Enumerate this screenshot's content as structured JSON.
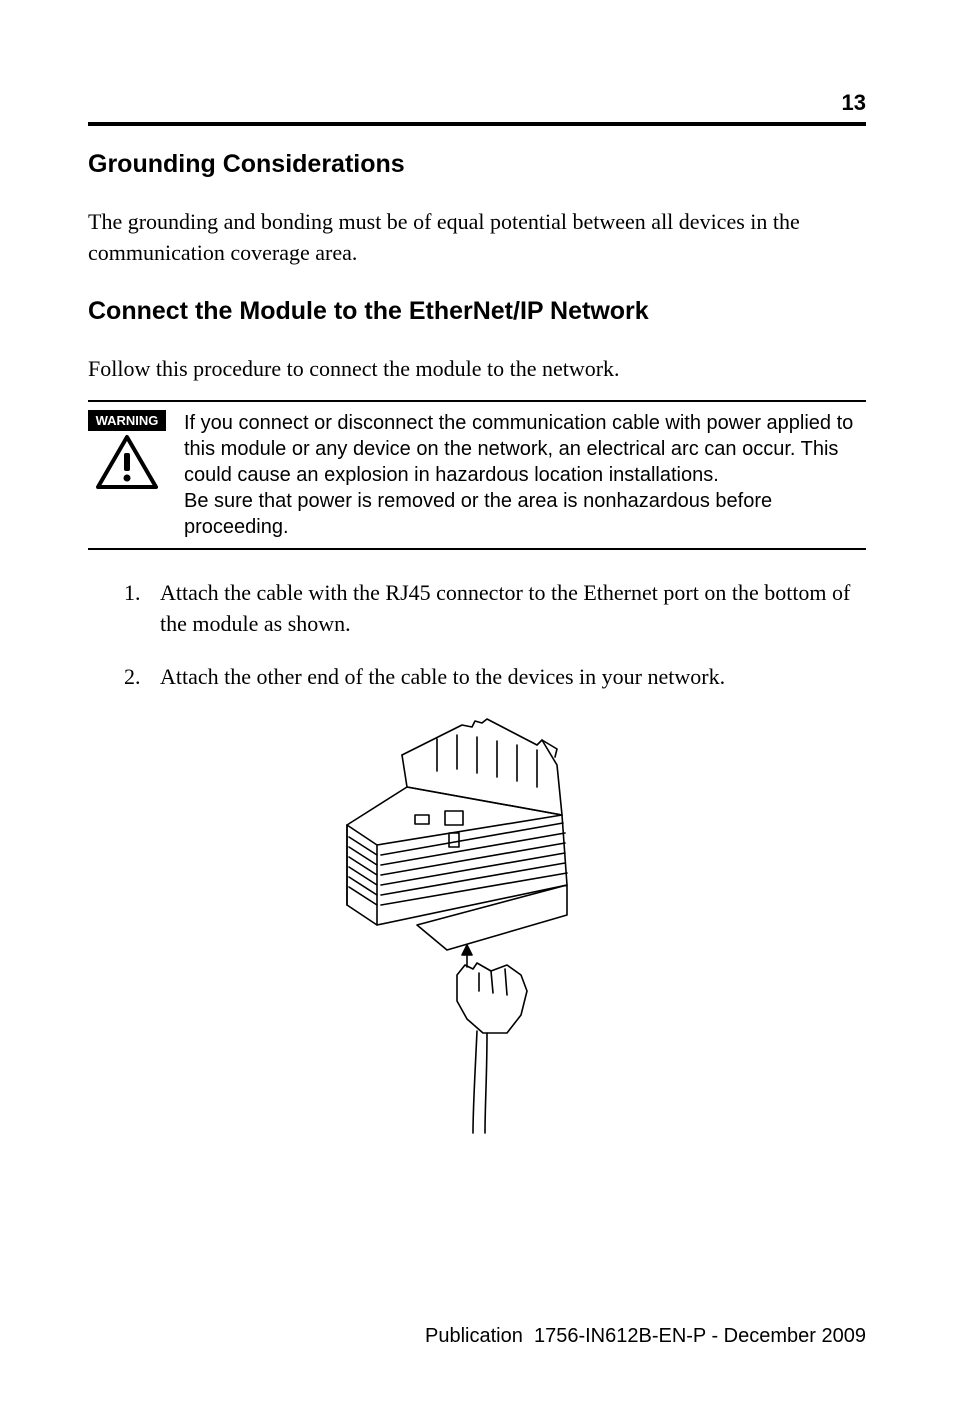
{
  "page_number": "13",
  "heading1": "Grounding Considerations",
  "para1": "The grounding and bonding must be of equal potential between all devices in the communication coverage area.",
  "heading2": "Connect the Module to the EtherNet/IP Network",
  "para2": "Follow this procedure to connect the module to the network.",
  "warning": {
    "label": "WARNING",
    "text_line1": "If you connect or disconnect the communication cable with power applied to this module or any device on the network, an electrical arc can occur. This could cause an explosion in hazardous location installations.",
    "text_line2": "Be sure that power is removed or the area is nonhazardous before proceeding."
  },
  "steps": [
    "Attach the cable with the RJ45 connector to the Ethernet port on the bottom of the module as shown.",
    "Attach the other end of the cable to the devices in your network."
  ],
  "footer_prefix": "Publication",
  "footer_code": "1756-IN612B-EN-P - December 2009"
}
